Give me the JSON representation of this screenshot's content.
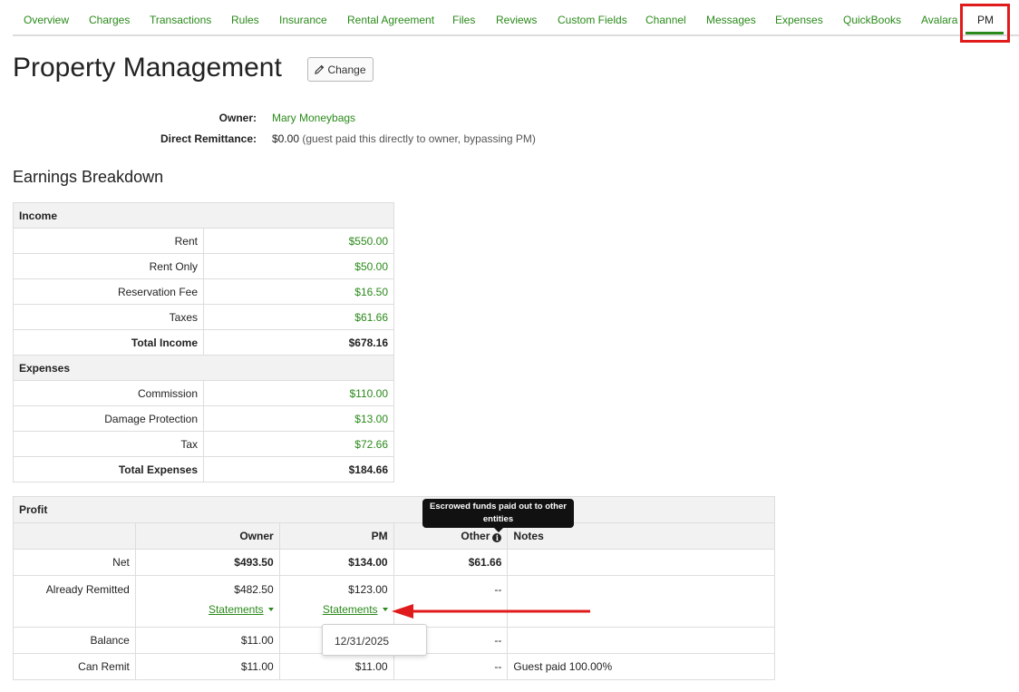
{
  "tabs": [
    {
      "label": "Overview"
    },
    {
      "label": "Charges"
    },
    {
      "label": "Transactions"
    },
    {
      "label": "Rules"
    },
    {
      "label": "Insurance"
    },
    {
      "label": "Rental Agreement"
    },
    {
      "label": "Files"
    },
    {
      "label": "Reviews"
    },
    {
      "label": "Custom Fields"
    },
    {
      "label": "Channel"
    },
    {
      "label": "Messages"
    },
    {
      "label": "Expenses"
    },
    {
      "label": "QuickBooks"
    },
    {
      "label": "Avalara"
    },
    {
      "label": "PM"
    }
  ],
  "active_tab": "PM",
  "page": {
    "title": "Property Management",
    "change_label": "Change"
  },
  "owner": {
    "owner_label": "Owner:",
    "owner_name": "Mary Moneybags",
    "remit_label": "Direct Remittance:",
    "remit_amount": "$0.00",
    "remit_note": "(guest paid this directly to owner, bypassing PM)"
  },
  "earnings": {
    "heading": "Earnings Breakdown",
    "income_label": "Income",
    "income_rows": [
      {
        "label": "Rent",
        "value": "$550.00"
      },
      {
        "label": "Rent Only",
        "value": "$50.00"
      },
      {
        "label": "Reservation Fee",
        "value": "$16.50"
      },
      {
        "label": "Taxes",
        "value": "$61.66"
      }
    ],
    "total_income_label": "Total Income",
    "total_income": "$678.16",
    "expenses_label": "Expenses",
    "expense_rows": [
      {
        "label": "Commission",
        "value": "$110.00"
      },
      {
        "label": "Damage Protection",
        "value": "$13.00"
      },
      {
        "label": "Tax",
        "value": "$72.66"
      }
    ],
    "total_expenses_label": "Total Expenses",
    "total_expenses": "$184.66"
  },
  "profit": {
    "label": "Profit",
    "headers": {
      "owner": "Owner",
      "pm": "PM",
      "other": "Other",
      "notes": "Notes"
    },
    "net": {
      "label": "Net",
      "owner": "$493.50",
      "pm": "$134.00",
      "other": "$61.66",
      "notes": ""
    },
    "remitted": {
      "label": "Already Remitted",
      "owner": "$482.50",
      "pm": "$123.00",
      "other": "--",
      "notes": "",
      "statements_label": "Statements"
    },
    "balance": {
      "label": "Balance",
      "owner": "$11.00",
      "pm": "",
      "other": "--",
      "notes": ""
    },
    "can_remit": {
      "label": "Can Remit",
      "owner": "$11.00",
      "pm": "$11.00",
      "other": "--",
      "notes": "Guest paid 100.00%"
    }
  },
  "tooltip": {
    "text": "Escrowed funds paid out to other entities"
  },
  "statements_dropdown": {
    "items": [
      "12/31/2025"
    ]
  },
  "colors": {
    "link": "#2a8a1a",
    "highlight": "#e01b1b",
    "arrow": "#e01b1b"
  }
}
